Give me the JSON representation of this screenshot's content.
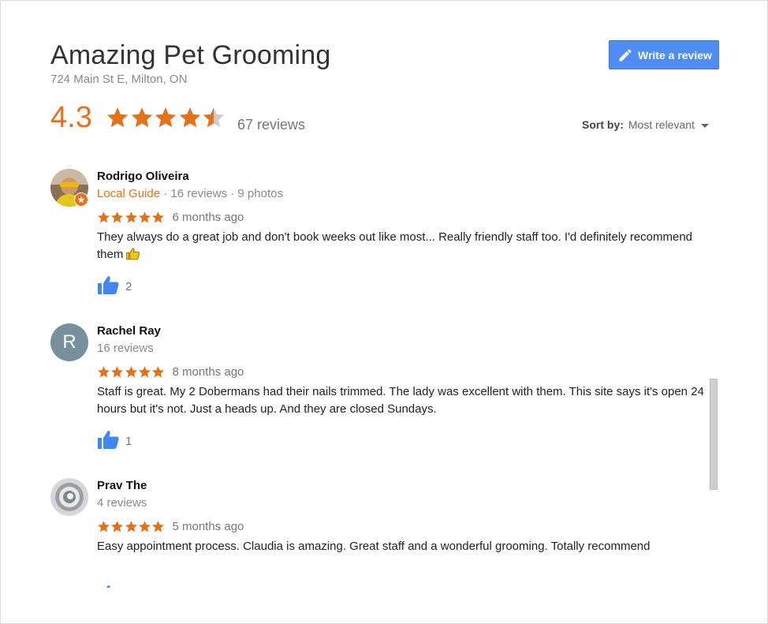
{
  "business": {
    "name": "Amazing Pet Grooming",
    "address": "724 Main St E, Milton, ON"
  },
  "write_review_label": "Write a review",
  "summary": {
    "rating": "4.3",
    "rating_value": 4.3,
    "review_count": "67 reviews"
  },
  "sort": {
    "label": "Sort by:",
    "value": "Most relevant"
  },
  "colors": {
    "accent": "#e7711b",
    "button": "#4e8df5",
    "thumb": "#4285f4",
    "star_empty": "#cccccc"
  },
  "reviews": [
    {
      "name": "Rodrigo Oliveira",
      "guide": "Local Guide",
      "meta": " · 16 reviews · 9 photos",
      "stars": 5,
      "date": "6 months ago",
      "text": "They always do a great job and don't book weeks out like most... Really friendly staff too. I'd definitely recommend them",
      "likes": "2"
    },
    {
      "name": "Rachel Ray",
      "avatar_letter": "R",
      "meta": "16 reviews",
      "stars": 5,
      "date": "8 months ago",
      "text": "Staff is great. My 2 Dobermans had their nails trimmed. The lady was excellent with them. This site says it's open 24 hours but it's not. Just a heads up. And they are closed Sundays.",
      "likes": "1"
    },
    {
      "name": "Prav The",
      "meta": "4 reviews",
      "stars": 5,
      "date": "5 months ago",
      "text": "Easy appointment process. Claudia is amazing. Great staff and a wonderful grooming. Totally recommend"
    }
  ]
}
